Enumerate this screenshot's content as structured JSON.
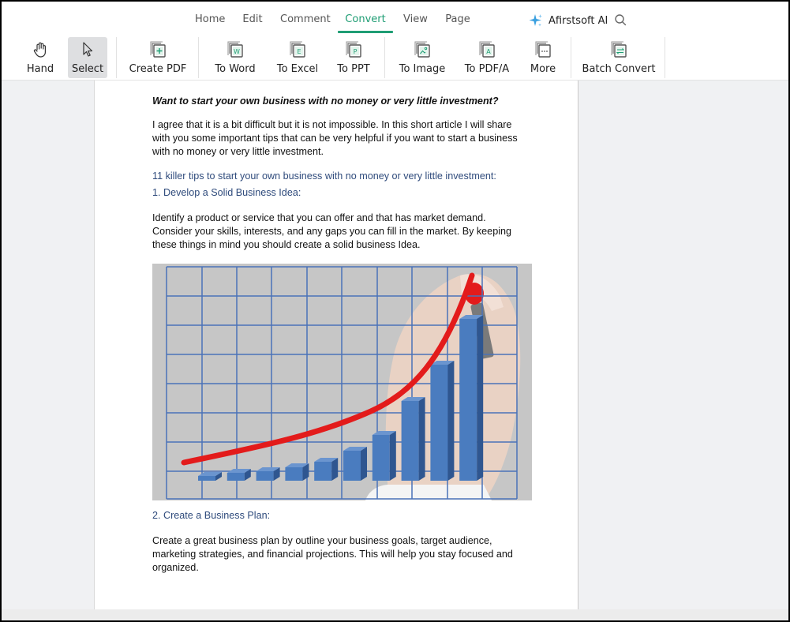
{
  "app": {
    "menu_tabs": [
      {
        "label": "Home",
        "active": false
      },
      {
        "label": "Edit",
        "active": false
      },
      {
        "label": "Comment",
        "active": false
      },
      {
        "label": "Convert",
        "active": true
      },
      {
        "label": "View",
        "active": false
      },
      {
        "label": "Page",
        "active": false
      }
    ],
    "ai_button": {
      "label": "Afirstsoft AI",
      "icon": "sparkle-icon"
    },
    "search_icon": "search-icon",
    "accent_color": "#1f9d74"
  },
  "toolbar": {
    "items": [
      {
        "label": "Hand",
        "icon": "hand-icon",
        "selected": false
      },
      {
        "label": "Select",
        "icon": "cursor-icon",
        "selected": true
      },
      {
        "label": "Create PDF",
        "icon": "create-pdf-icon",
        "glyph": "+"
      },
      {
        "label": "To Word",
        "icon": "to-word-icon",
        "glyph": "W"
      },
      {
        "label": "To Excel",
        "icon": "to-excel-icon",
        "glyph": "E"
      },
      {
        "label": "To PPT",
        "icon": "to-ppt-icon",
        "glyph": "P"
      },
      {
        "label": "To Image",
        "icon": "to-image-icon",
        "glyph": "img"
      },
      {
        "label": "To PDF/A",
        "icon": "to-pdfa-icon",
        "glyph": "A"
      },
      {
        "label": "More",
        "icon": "more-icon",
        "glyph": "..."
      },
      {
        "label": "Batch Convert",
        "icon": "batch-convert-icon",
        "glyph": "⇄"
      }
    ]
  },
  "document": {
    "title": "Want to start your own business with no money or very little investment?",
    "intro": "I agree that it is a bit difficult but it is not impossible. In this short article I will share with you some important tips that can be very helpful if you want to start a business with no money or very little investment.",
    "tips_heading": "11 killer tips to start your own business with no money or very little investment:",
    "tip1_heading": "1. Develop a Solid Business Idea:",
    "tip1_body": "Identify a product or service that you can offer and that has market demand. Consider your skills, interests, and any gaps you can fill in the market. By keeping these things in mind you should create a solid business Idea.",
    "image_alt": "Rising bar chart with red growth curve drawn by hand",
    "tip2_heading": "2. Create a Business Plan:",
    "tip2_body": "Create a great business plan by outline your business goals, target audience, marketing strategies, and financial projections. This will help you stay focused and organized."
  }
}
